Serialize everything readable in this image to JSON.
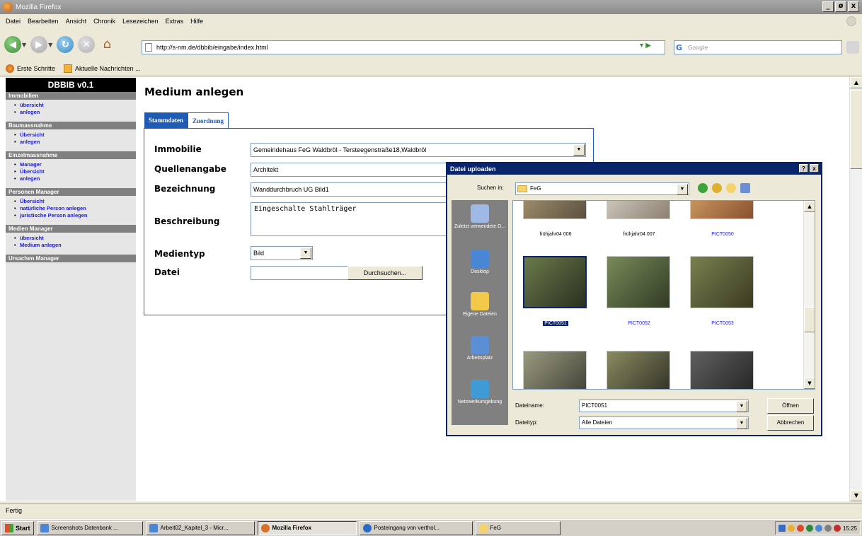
{
  "window": {
    "title": "Mozilla Firefox",
    "buttons": [
      "_",
      "ø",
      "x"
    ]
  },
  "menu": [
    "Datei",
    "Bearbeiten",
    "Ansicht",
    "Chronik",
    "Lesezeichen",
    "Extras",
    "Hilfe"
  ],
  "nav": {
    "url": "http://s-nm.de/dbbib/eingabe/index.html",
    "search_placeholder": "Google",
    "search_engine_glyph": "G"
  },
  "bookmarks": [
    "Erste Schritte",
    "Aktuelle Nachrichten ..."
  ],
  "sidebar": {
    "brand": "DBBIB v0.1",
    "sections": [
      {
        "title": "Immobilien",
        "items": [
          "übersicht",
          "anlegen"
        ]
      },
      {
        "title": "Baumassnahme",
        "items": [
          "Übersicht",
          "anlegen"
        ]
      },
      {
        "title": "Einzelmassnahme",
        "items": [
          "Manager",
          "Übersicht",
          "anlegen"
        ]
      },
      {
        "title": "Personen Manager",
        "items": [
          "Übersicht",
          "natürliche Person anlegen",
          "juristische Person anlegen"
        ]
      },
      {
        "title": "Medien Manager",
        "items": [
          "übersicht",
          "Medium anlegen"
        ]
      },
      {
        "title": "Ursachen Manager",
        "items": []
      }
    ]
  },
  "main": {
    "title": "Medium anlegen",
    "tabs": [
      "Stammdaten",
      "Zuordnung"
    ],
    "form": {
      "immobilie_label": "Immobilie",
      "immobilie_value": "Gemeindehaus FeG Waldbröl - Tersteegenstraße18,Waldbröl",
      "quelle_label": "Quellenangabe",
      "quelle_value": "Architekt",
      "bezeichnung_label": "Bezeichnung",
      "bezeichnung_value": "Wanddurchbruch UG Bild1",
      "beschreibung_label": "Beschreibung",
      "beschreibung_value": "Eingeschalte Stahlträger",
      "medientyp_label": "Medientyp",
      "medientyp_value": "Bild",
      "datei_label": "Datei",
      "datei_value": "",
      "browse_label": "Durchsuchen..."
    }
  },
  "dialog": {
    "title": "Datei uploaden",
    "title_buttons": [
      "?",
      "x"
    ],
    "lookin_label": "Suchen in:",
    "lookin_value": "FeG",
    "places": [
      "Zuletzt verwendete D...",
      "Desktop",
      "Eigene Dateien",
      "Arbeitsplatz",
      "Netzwerkumgebung"
    ],
    "files": [
      "frühjahr04 006",
      "frühjahr04 007",
      "PICT0050",
      "PICT0051",
      "PICT0052",
      "PICT0053"
    ],
    "filename_label": "Dateiname:",
    "filename_value": "PICT0051",
    "filetype_label": "Dateityp:",
    "filetype_value": "Alle Dateien",
    "open_label": "Öffnen",
    "cancel_label": "Abbrechen"
  },
  "status": "Fertig",
  "taskbar": {
    "start": "Start",
    "buttons": [
      "Screenshots Datenbank ...",
      "Arbeit02_Kapitel_3 - Micr...",
      "Mozilla Firefox",
      "Posteingang von verthol...",
      "FeG"
    ],
    "clock": "15:25"
  }
}
